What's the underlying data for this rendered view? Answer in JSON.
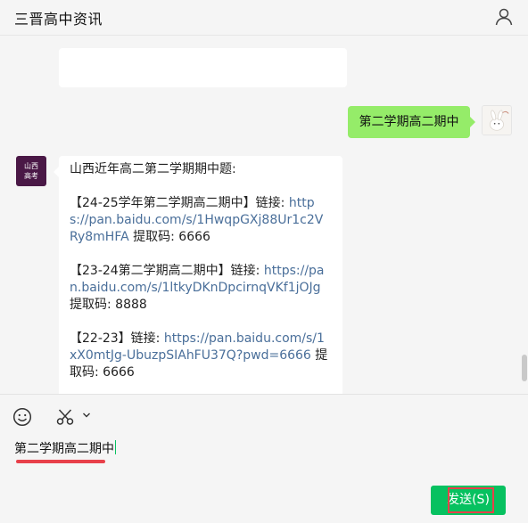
{
  "header": {
    "title": "三晋高中资讯",
    "profile_icon": "person-icon"
  },
  "chat": {
    "outgoing": {
      "text": "第二学期高二期中",
      "bubble_color": "#95ec69"
    },
    "bot_avatar": {
      "line1": "山西",
      "line2": "高考",
      "color": "#4a1846"
    },
    "reply": {
      "intro": "山西近年高二第二学期期中题:",
      "items": [
        {
          "label": "【24-25学年第二学期高二期中】链接: ",
          "link": "https://pan.baidu.com/s/1HwqpGXj88Ur1c2VRy8mHFA",
          "code_label": " 提取码: ",
          "code": "6666"
        },
        {
          "label": "【23-24第二学期高二期中】链接: ",
          "link": "https://pan.baidu.com/s/1ltkyDKnDpcirnqVKf1jOJg",
          "code_label": " 提取码: ",
          "code": "8888"
        },
        {
          "label": "【22-23】链接: ",
          "link": "https://pan.baidu.com/s/1xX0mtJg-UbuzpSIAhFU37Q?pwd=6666",
          "code_label": " 提取码: ",
          "code": "6666"
        }
      ],
      "link_color": "#4a6f9a"
    }
  },
  "input": {
    "value": "第二学期高二期中",
    "send_label": "发送(S)",
    "accent": "#07c160",
    "highlight": "#e8404a"
  },
  "toolbar": {
    "icons": [
      "emoji-icon",
      "scissors-icon",
      "chevron-down-icon"
    ]
  }
}
